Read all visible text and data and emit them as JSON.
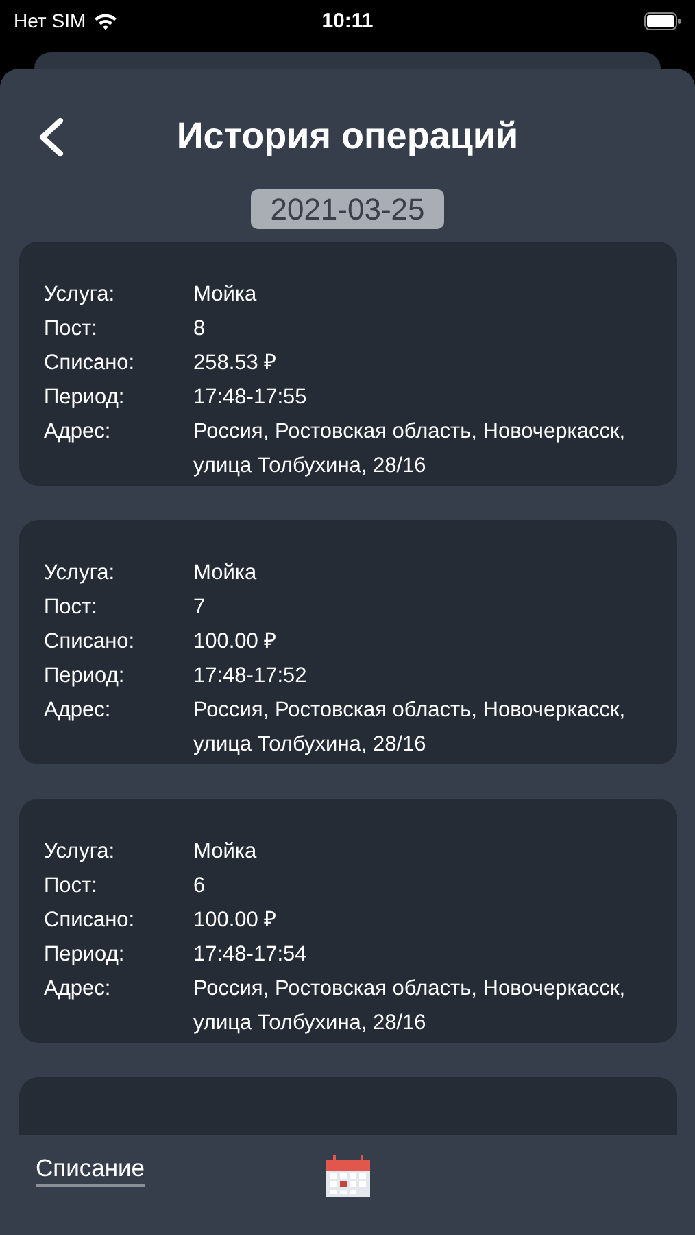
{
  "status_bar": {
    "carrier": "Нет SIM",
    "time": "10:11"
  },
  "header": {
    "title": "История операций"
  },
  "date": "2021-03-25",
  "operations": [
    {
      "fields": [
        {
          "label": "Услуга:",
          "value": "Мойка"
        },
        {
          "label": "Пост:",
          "value": "8"
        },
        {
          "label": "Списано:",
          "value": "258.53 ₽"
        },
        {
          "label": "Период:",
          "value": "17:48-17:55"
        },
        {
          "label": "Адрес:",
          "value": "Россия, Ростовская область, Новочеркасск, улица Толбухина, 28/16"
        }
      ]
    },
    {
      "fields": [
        {
          "label": "Услуга:",
          "value": "Мойка"
        },
        {
          "label": "Пост:",
          "value": "7"
        },
        {
          "label": "Списано:",
          "value": "100.00 ₽"
        },
        {
          "label": "Период:",
          "value": "17:48-17:52"
        },
        {
          "label": "Адрес:",
          "value": "Россия, Ростовская область, Новочеркасск, улица Толбухина, 28/16"
        }
      ]
    },
    {
      "fields": [
        {
          "label": "Услуга:",
          "value": "Мойка"
        },
        {
          "label": "Пост:",
          "value": "6"
        },
        {
          "label": "Списано:",
          "value": "100.00 ₽"
        },
        {
          "label": "Период:",
          "value": "17:48-17:54"
        },
        {
          "label": "Адрес:",
          "value": "Россия, Ростовская область, Новочеркасск, улица Толбухина, 28/16"
        }
      ]
    }
  ],
  "bottom_bar": {
    "tab": {
      "label": "Списание",
      "selected": true
    }
  }
}
